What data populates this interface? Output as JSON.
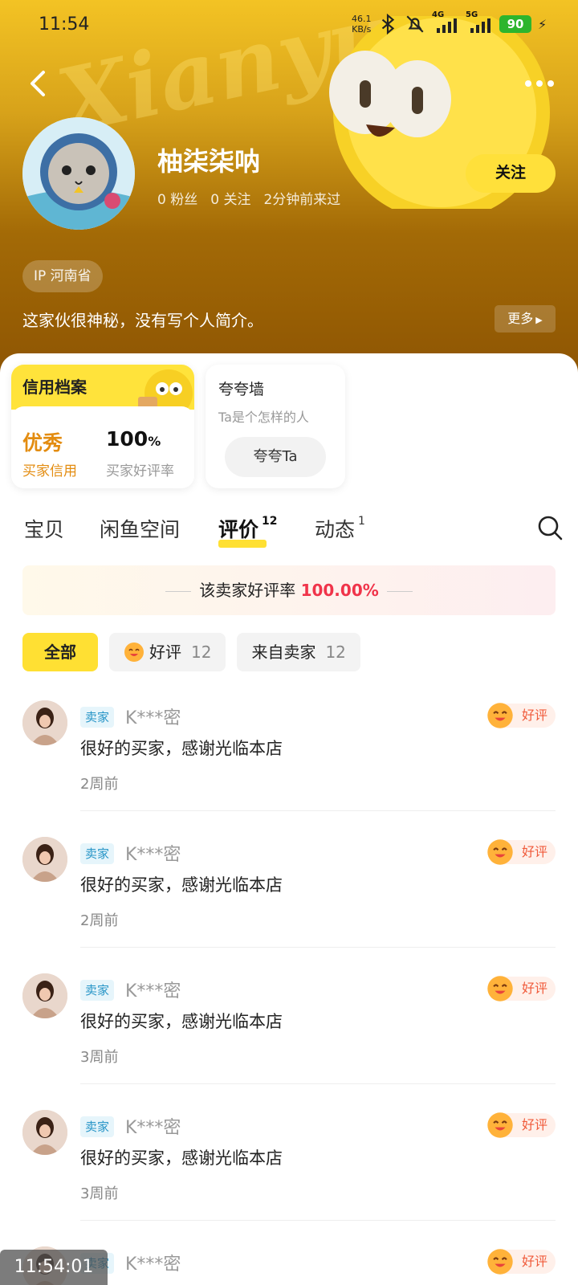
{
  "status_bar": {
    "time": "11:54",
    "net_speed_value": "46.1",
    "net_speed_unit": "KB/s",
    "network_4g": "4G",
    "network_5g": "5G",
    "battery": "90",
    "icons": [
      "bluetooth-icon",
      "mute-icon",
      "signal-4g-icon",
      "signal-5g-icon",
      "battery-icon",
      "charging-icon"
    ]
  },
  "header": {
    "watermark": "Xianyu",
    "username": "柚柒柒呐",
    "stats": [
      "0 粉丝",
      "0 关注",
      "2分钟前来过"
    ],
    "follow_label": "关注",
    "ip_label": "IP 河南省",
    "bio": "这家伙很神秘，没有写个人简介。",
    "bio_more_label": "更多"
  },
  "credit": {
    "title": "信用档案",
    "rating": "优秀",
    "rating_label": "买家信用",
    "rate_value": "100",
    "rate_unit": "%",
    "rate_label": "买家好评率"
  },
  "praise": {
    "title": "夸夸墙",
    "subtitle": "Ta是个怎样的人",
    "button_label": "夸夸Ta"
  },
  "tabs": [
    {
      "label": "宝贝",
      "count": ""
    },
    {
      "label": "闲鱼空间",
      "count": ""
    },
    {
      "label": "评价",
      "count": "12"
    },
    {
      "label": "动态",
      "count": "1"
    }
  ],
  "rate_banner": {
    "label": "该卖家好评率",
    "value": "100.00%"
  },
  "filters": [
    {
      "label": "全部",
      "count": ""
    },
    {
      "label": "好评",
      "count": "12"
    },
    {
      "label": "来自卖家",
      "count": "12"
    }
  ],
  "reviews": [
    {
      "tag": "卖家",
      "name": "K***密",
      "text": "很好的买家，感谢光临本店",
      "time": "2周前",
      "badge": "好评"
    },
    {
      "tag": "卖家",
      "name": "K***密",
      "text": "很好的买家，感谢光临本店",
      "time": "2周前",
      "badge": "好评"
    },
    {
      "tag": "卖家",
      "name": "K***密",
      "text": "很好的买家，感谢光临本店",
      "time": "3周前",
      "badge": "好评"
    },
    {
      "tag": "卖家",
      "name": "K***密",
      "text": "很好的买家，感谢光临本店",
      "time": "3周前",
      "badge": "好评"
    },
    {
      "tag": "卖家",
      "name": "K***密",
      "text": "",
      "time": "",
      "badge": "好评"
    }
  ],
  "overlay_time": "11:54:01",
  "colors": {
    "accent_yellow": "#ffe033",
    "rating_orange": "#e38c10",
    "rate_red": "#f0344a",
    "seller_blue": "#2795c7"
  }
}
